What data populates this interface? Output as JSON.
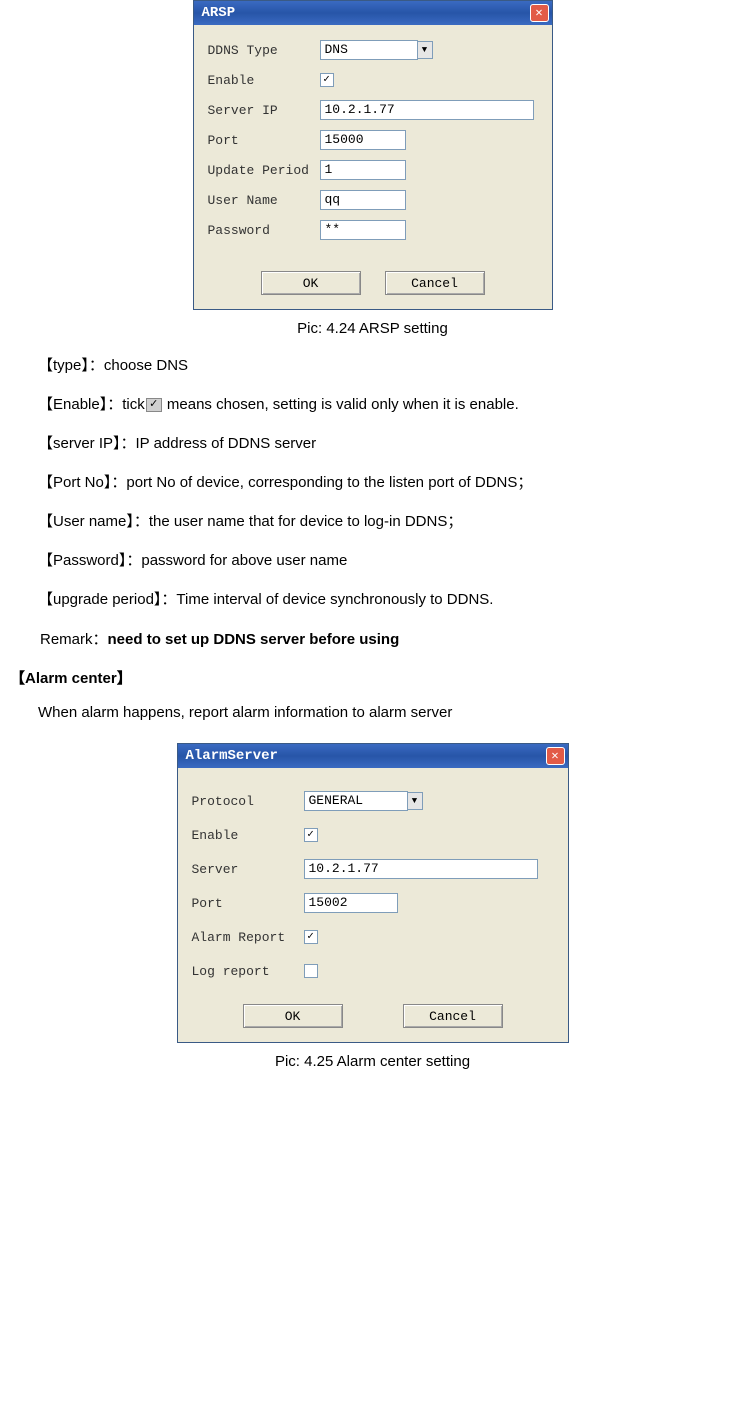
{
  "arsp_dialog": {
    "title": "ARSP",
    "labels": {
      "ddns_type": "DDNS Type",
      "enable": "Enable",
      "server_ip": "Server IP",
      "port": "Port",
      "update_period": "Update Period",
      "user_name": "User Name",
      "password": "Password"
    },
    "values": {
      "ddns_type": "DNS",
      "enable_checked": "✓",
      "server_ip": "10.2.1.77",
      "port": "15000",
      "update_period": "1",
      "user_name": "qq",
      "password": "**"
    },
    "buttons": {
      "ok": "OK",
      "cancel": "Cancel"
    }
  },
  "caption1": "Pic: 4.24 ARSP setting",
  "descriptions": {
    "type": "【type】：choose DNS",
    "enable_a": "【Enable】：tick",
    "enable_check": "✓",
    "enable_b": " means chosen, setting is valid only when it is enable.",
    "server_ip": "【server IP】：IP address of DDNS server",
    "port_no": "【Port No】：port No of device, corresponding to the listen port of DDNS；",
    "user_name": "【User name】：the user name that for device to log-in DDNS；",
    "password": "【Password】：password for above user name",
    "upgrade_period": "【upgrade period】：Time interval of device synchronously to DDNS."
  },
  "remark": {
    "label": "Remark：",
    "text": "need to set up DDNS server before using"
  },
  "alarm_header": "【Alarm center】",
  "alarm_desc": "When alarm happens, report alarm information to alarm server",
  "alarm_dialog": {
    "title": "AlarmServer",
    "labels": {
      "protocol": "Protocol",
      "enable": "Enable",
      "server": "Server",
      "port": "Port",
      "alarm_report": "Alarm Report",
      "log_report": "Log report"
    },
    "values": {
      "protocol": "GENERAL",
      "enable_checked": "✓",
      "server": "10.2.1.77",
      "port": "15002",
      "alarm_report_checked": "✓",
      "log_report_checked": ""
    },
    "buttons": {
      "ok": "OK",
      "cancel": "Cancel"
    }
  },
  "caption2": "Pic: 4.25 Alarm center setting"
}
